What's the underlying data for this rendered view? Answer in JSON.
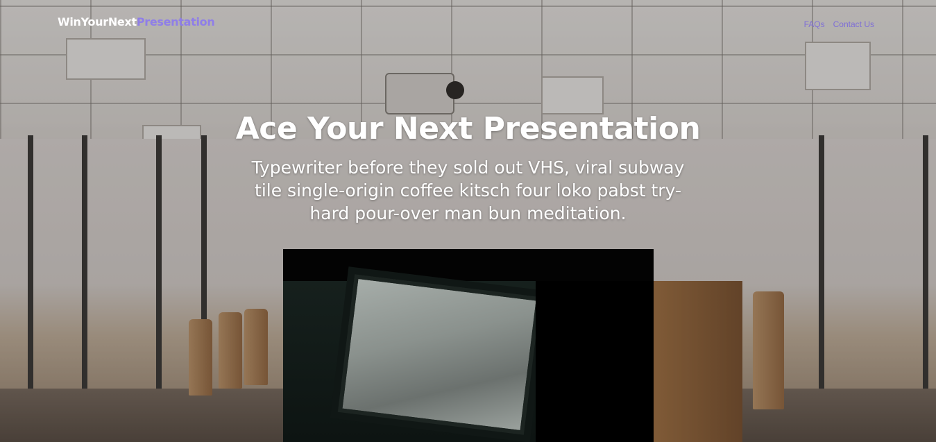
{
  "brand": {
    "part1": "WinYourNext",
    "part2": "Presentation"
  },
  "nav": {
    "items": [
      {
        "label": "FAQs"
      },
      {
        "label": "Contact Us"
      }
    ]
  },
  "hero": {
    "title": "Ace Your Next Presentation",
    "subtitle": "Typewriter before they sold out VHS, viral subway tile single-origin coffee kitsch four loko pabst try-hard pour-over man bun meditation."
  },
  "colors": {
    "accent": "#8f7ee8",
    "nav_link": "#7f6fd6",
    "text": "#ffffff",
    "video_bg": "#030303"
  },
  "icons": {
    "video": "video-player"
  }
}
